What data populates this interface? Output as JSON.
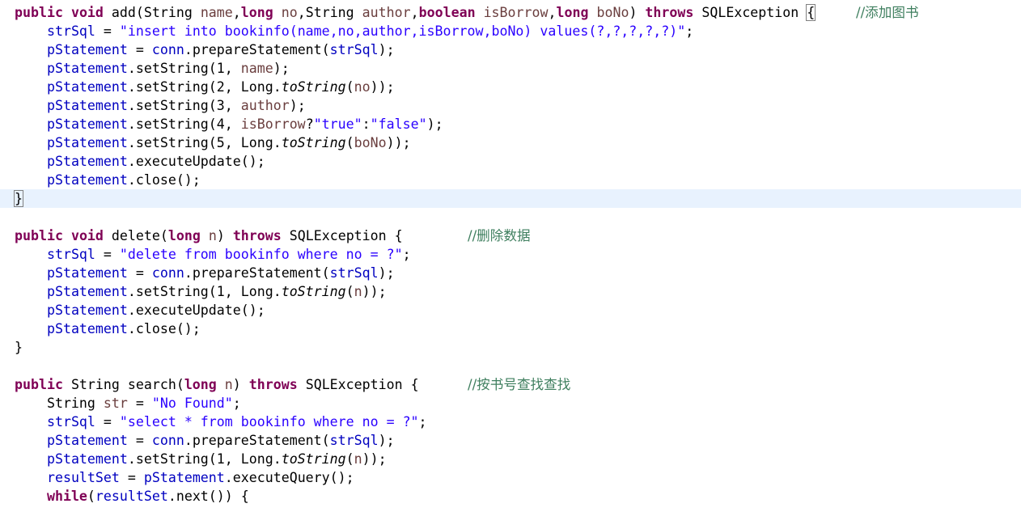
{
  "editor": {
    "colors": {
      "keyword": "#7f0055",
      "field": "#0000c0",
      "parameter": "#6a3e3e",
      "string": "#2a00ff",
      "comment": "#3f7f5f",
      "current_line": "#e8f2fe"
    },
    "lines": [
      {
        "comment": "//添加图书",
        "tokens": [
          {
            "t": "kw",
            "v": "public"
          },
          {
            "t": "plain",
            "v": " "
          },
          {
            "t": "kw",
            "v": "void"
          },
          {
            "t": "plain",
            "v": " add(String "
          },
          {
            "t": "param",
            "v": "name"
          },
          {
            "t": "plain",
            "v": ","
          },
          {
            "t": "kw",
            "v": "long"
          },
          {
            "t": "plain",
            "v": " "
          },
          {
            "t": "param",
            "v": "no"
          },
          {
            "t": "plain",
            "v": ",String "
          },
          {
            "t": "param",
            "v": "author"
          },
          {
            "t": "plain",
            "v": ","
          },
          {
            "t": "kw",
            "v": "boolean"
          },
          {
            "t": "plain",
            "v": " "
          },
          {
            "t": "param",
            "v": "isBorrow"
          },
          {
            "t": "plain",
            "v": ","
          },
          {
            "t": "kw",
            "v": "long"
          },
          {
            "t": "plain",
            "v": " "
          },
          {
            "t": "param",
            "v": "boNo"
          },
          {
            "t": "plain",
            "v": ") "
          },
          {
            "t": "kw",
            "v": "throws"
          },
          {
            "t": "plain",
            "v": " SQLException "
          },
          {
            "t": "bracket",
            "v": "{"
          }
        ]
      },
      {
        "tokens": [
          {
            "t": "plain",
            "v": "    "
          },
          {
            "t": "field",
            "v": "strSql"
          },
          {
            "t": "plain",
            "v": " = "
          },
          {
            "t": "str",
            "v": "\"insert into bookinfo(name,no,author,isBorrow,boNo) values(?,?,?,?,?)\""
          },
          {
            "t": "plain",
            "v": ";"
          }
        ]
      },
      {
        "tokens": [
          {
            "t": "plain",
            "v": "    "
          },
          {
            "t": "field",
            "v": "pStatement"
          },
          {
            "t": "plain",
            "v": " = "
          },
          {
            "t": "field",
            "v": "conn"
          },
          {
            "t": "plain",
            "v": ".prepareStatement("
          },
          {
            "t": "field",
            "v": "strSql"
          },
          {
            "t": "plain",
            "v": ");"
          }
        ]
      },
      {
        "tokens": [
          {
            "t": "plain",
            "v": "    "
          },
          {
            "t": "field",
            "v": "pStatement"
          },
          {
            "t": "plain",
            "v": ".setString(1, "
          },
          {
            "t": "param",
            "v": "name"
          },
          {
            "t": "plain",
            "v": ");"
          }
        ]
      },
      {
        "tokens": [
          {
            "t": "plain",
            "v": "    "
          },
          {
            "t": "field",
            "v": "pStatement"
          },
          {
            "t": "plain",
            "v": ".setString(2, Long."
          },
          {
            "t": "static",
            "v": "toString"
          },
          {
            "t": "plain",
            "v": "("
          },
          {
            "t": "param",
            "v": "no"
          },
          {
            "t": "plain",
            "v": "));"
          }
        ]
      },
      {
        "tokens": [
          {
            "t": "plain",
            "v": "    "
          },
          {
            "t": "field",
            "v": "pStatement"
          },
          {
            "t": "plain",
            "v": ".setString(3, "
          },
          {
            "t": "param",
            "v": "author"
          },
          {
            "t": "plain",
            "v": ");"
          }
        ]
      },
      {
        "tokens": [
          {
            "t": "plain",
            "v": "    "
          },
          {
            "t": "field",
            "v": "pStatement"
          },
          {
            "t": "plain",
            "v": ".setString(4, "
          },
          {
            "t": "param",
            "v": "isBorrow"
          },
          {
            "t": "plain",
            "v": "?"
          },
          {
            "t": "str",
            "v": "\"true\""
          },
          {
            "t": "plain",
            "v": ":"
          },
          {
            "t": "str",
            "v": "\"false\""
          },
          {
            "t": "plain",
            "v": ");"
          }
        ]
      },
      {
        "tokens": [
          {
            "t": "plain",
            "v": "    "
          },
          {
            "t": "field",
            "v": "pStatement"
          },
          {
            "t": "plain",
            "v": ".setString(5, Long."
          },
          {
            "t": "static",
            "v": "toString"
          },
          {
            "t": "plain",
            "v": "("
          },
          {
            "t": "param",
            "v": "boNo"
          },
          {
            "t": "plain",
            "v": "));"
          }
        ]
      },
      {
        "tokens": [
          {
            "t": "plain",
            "v": "    "
          },
          {
            "t": "field",
            "v": "pStatement"
          },
          {
            "t": "plain",
            "v": ".executeUpdate();"
          }
        ]
      },
      {
        "tokens": [
          {
            "t": "plain",
            "v": "    "
          },
          {
            "t": "field",
            "v": "pStatement"
          },
          {
            "t": "plain",
            "v": ".close();"
          }
        ]
      },
      {
        "current": true,
        "tokens": [
          {
            "t": "bracket",
            "v": "}"
          },
          {
            "t": "cursor",
            "v": ""
          }
        ]
      },
      {
        "tokens": []
      },
      {
        "comment": "//删除数据",
        "tokens": [
          {
            "t": "kw",
            "v": "public"
          },
          {
            "t": "plain",
            "v": " "
          },
          {
            "t": "kw",
            "v": "void"
          },
          {
            "t": "plain",
            "v": " delete("
          },
          {
            "t": "kw",
            "v": "long"
          },
          {
            "t": "plain",
            "v": " "
          },
          {
            "t": "param",
            "v": "n"
          },
          {
            "t": "plain",
            "v": ") "
          },
          {
            "t": "kw",
            "v": "throws"
          },
          {
            "t": "plain",
            "v": " SQLException {"
          }
        ]
      },
      {
        "tokens": [
          {
            "t": "plain",
            "v": "    "
          },
          {
            "t": "field",
            "v": "strSql"
          },
          {
            "t": "plain",
            "v": " = "
          },
          {
            "t": "str",
            "v": "\"delete from bookinfo where no = ?\""
          },
          {
            "t": "plain",
            "v": ";"
          }
        ]
      },
      {
        "tokens": [
          {
            "t": "plain",
            "v": "    "
          },
          {
            "t": "field",
            "v": "pStatement"
          },
          {
            "t": "plain",
            "v": " = "
          },
          {
            "t": "field",
            "v": "conn"
          },
          {
            "t": "plain",
            "v": ".prepareStatement("
          },
          {
            "t": "field",
            "v": "strSql"
          },
          {
            "t": "plain",
            "v": ");"
          }
        ]
      },
      {
        "tokens": [
          {
            "t": "plain",
            "v": "    "
          },
          {
            "t": "field",
            "v": "pStatement"
          },
          {
            "t": "plain",
            "v": ".setString(1, Long."
          },
          {
            "t": "static",
            "v": "toString"
          },
          {
            "t": "plain",
            "v": "("
          },
          {
            "t": "param",
            "v": "n"
          },
          {
            "t": "plain",
            "v": "));"
          }
        ]
      },
      {
        "tokens": [
          {
            "t": "plain",
            "v": "    "
          },
          {
            "t": "field",
            "v": "pStatement"
          },
          {
            "t": "plain",
            "v": ".executeUpdate();"
          }
        ]
      },
      {
        "tokens": [
          {
            "t": "plain",
            "v": "    "
          },
          {
            "t": "field",
            "v": "pStatement"
          },
          {
            "t": "plain",
            "v": ".close();"
          }
        ]
      },
      {
        "tokens": [
          {
            "t": "plain",
            "v": "}"
          }
        ]
      },
      {
        "tokens": []
      },
      {
        "comment": "//按书号查找查找",
        "tokens": [
          {
            "t": "kw",
            "v": "public"
          },
          {
            "t": "plain",
            "v": " String search("
          },
          {
            "t": "kw",
            "v": "long"
          },
          {
            "t": "plain",
            "v": " "
          },
          {
            "t": "param",
            "v": "n"
          },
          {
            "t": "plain",
            "v": ") "
          },
          {
            "t": "kw",
            "v": "throws"
          },
          {
            "t": "plain",
            "v": " SQLException {"
          }
        ]
      },
      {
        "tokens": [
          {
            "t": "plain",
            "v": "    String "
          },
          {
            "t": "param",
            "v": "str"
          },
          {
            "t": "plain",
            "v": " = "
          },
          {
            "t": "str",
            "v": "\"No Found\""
          },
          {
            "t": "plain",
            "v": ";"
          }
        ]
      },
      {
        "tokens": [
          {
            "t": "plain",
            "v": "    "
          },
          {
            "t": "field",
            "v": "strSql"
          },
          {
            "t": "plain",
            "v": " = "
          },
          {
            "t": "str",
            "v": "\"select * from bookinfo where no = ?\""
          },
          {
            "t": "plain",
            "v": ";"
          }
        ]
      },
      {
        "tokens": [
          {
            "t": "plain",
            "v": "    "
          },
          {
            "t": "field",
            "v": "pStatement"
          },
          {
            "t": "plain",
            "v": " = "
          },
          {
            "t": "field",
            "v": "conn"
          },
          {
            "t": "plain",
            "v": ".prepareStatement("
          },
          {
            "t": "field",
            "v": "strSql"
          },
          {
            "t": "plain",
            "v": ");"
          }
        ]
      },
      {
        "tokens": [
          {
            "t": "plain",
            "v": "    "
          },
          {
            "t": "field",
            "v": "pStatement"
          },
          {
            "t": "plain",
            "v": ".setString(1, Long."
          },
          {
            "t": "static",
            "v": "toString"
          },
          {
            "t": "plain",
            "v": "("
          },
          {
            "t": "param",
            "v": "n"
          },
          {
            "t": "plain",
            "v": "));"
          }
        ]
      },
      {
        "tokens": [
          {
            "t": "plain",
            "v": "    "
          },
          {
            "t": "field",
            "v": "resultSet"
          },
          {
            "t": "plain",
            "v": " = "
          },
          {
            "t": "field",
            "v": "pStatement"
          },
          {
            "t": "plain",
            "v": ".executeQuery();"
          }
        ]
      },
      {
        "tokens": [
          {
            "t": "plain",
            "v": "    "
          },
          {
            "t": "kw",
            "v": "while"
          },
          {
            "t": "plain",
            "v": "("
          },
          {
            "t": "field",
            "v": "resultSet"
          },
          {
            "t": "plain",
            "v": ".next()) {"
          }
        ]
      }
    ]
  }
}
